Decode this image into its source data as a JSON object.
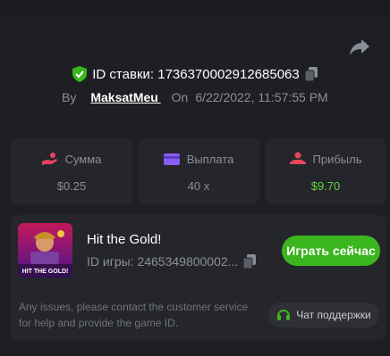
{
  "bet": {
    "id_label": "ID ставки: 1736370002912685063",
    "by_label": "By",
    "username": "MaksatMeu ",
    "on_label": "On",
    "timestamp": "6/22/2022, 11:57:55 PM"
  },
  "stats": [
    {
      "label": "Сумма",
      "value": "$0.25",
      "icon": "hand-coin-icon",
      "color": "#e8445a"
    },
    {
      "label": "Выплата",
      "value": "40 x",
      "icon": "wallet-icon",
      "color": "#8a5cf6"
    },
    {
      "label": "Прибыль",
      "value": "$9.70",
      "icon": "profit-hand-icon",
      "color": "#e8445a"
    }
  ],
  "game": {
    "title": "Hit the Gold!",
    "id_label": "ID игры: 2465349800002...",
    "thumb_text": "HIT THE GOLD!",
    "play_label": "Играть сейчас",
    "note": "Any issues, please contact the customer service for help and provide the game ID.",
    "support_label": "Чат поддержки"
  },
  "colors": {
    "background": "#1e1f23",
    "card": "#25262b",
    "accent_green": "#3bb61e",
    "profit_green": "#5fd33a",
    "muted": "#8b8e98"
  }
}
